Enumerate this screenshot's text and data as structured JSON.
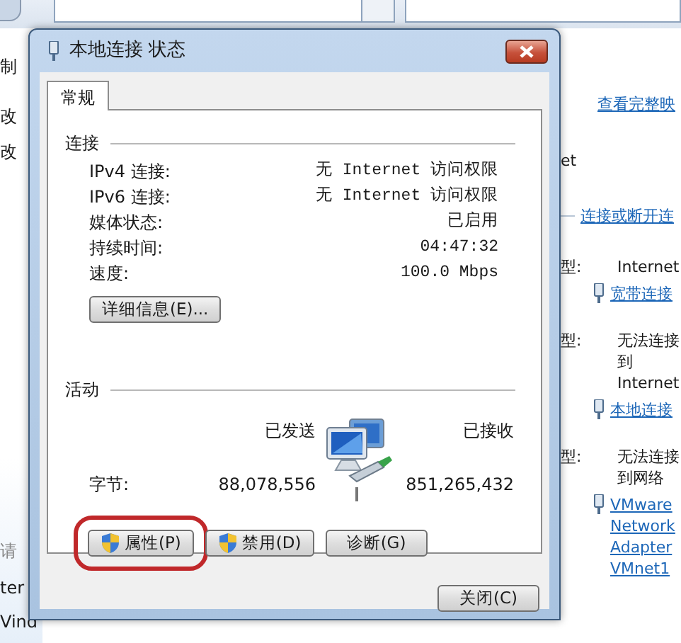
{
  "background": {
    "left_texts": [
      {
        "text": "制",
        "muted": false
      },
      {
        "text": "改",
        "muted": false
      },
      {
        "text": "改",
        "muted": false
      },
      {
        "text": "请",
        "muted": true
      },
      {
        "text": "ter",
        "muted": false
      },
      {
        "text": "Vind",
        "muted": false
      }
    ],
    "right_panel": [
      {
        "kind": "link",
        "text": "查看完整映"
      },
      {
        "kind": "text",
        "text": "et"
      },
      {
        "kind": "section_link",
        "text": "连接或断开连"
      },
      {
        "kind": "network",
        "type_label": "型:",
        "type_value": [
          "Internet"
        ],
        "connection": [
          "宽带连接"
        ]
      },
      {
        "kind": "network",
        "type_label": "型:",
        "type_value": [
          "无法连接",
          "到",
          "Internet"
        ],
        "connection": [
          "本地连接"
        ]
      },
      {
        "kind": "network",
        "type_label": "型:",
        "type_value": [
          "无法连接",
          "到网络"
        ],
        "connection": [
          "VMware",
          "Network",
          "Adapter",
          "VMnet1"
        ]
      }
    ]
  },
  "dialog": {
    "title": "本地连接 状态",
    "tabs": [
      {
        "label": "常规",
        "selected": true
      }
    ],
    "connection": {
      "heading": "连接",
      "rows": [
        {
          "label": "IPv4 连接:",
          "value": "无 Internet 访问权限"
        },
        {
          "label": "IPv6 连接:",
          "value": "无 Internet 访问权限"
        },
        {
          "label": "媒体状态:",
          "value": "已启用"
        },
        {
          "label": "持续时间:",
          "value": "04:47:32"
        },
        {
          "label": "速度:",
          "value": "100.0 Mbps"
        }
      ],
      "details_button": "详细信息(E)..."
    },
    "activity": {
      "heading": "活动",
      "sent_label": "已发送",
      "received_label": "已接收",
      "bytes_label": "字节:",
      "bytes_sent": "88,078,556",
      "bytes_received": "851,265,432"
    },
    "buttons": [
      {
        "label": "属性(P)",
        "shield": true,
        "highlighted": true
      },
      {
        "label": "禁用(D)",
        "shield": true,
        "highlighted": false
      },
      {
        "label": "诊断(G)",
        "shield": false,
        "highlighted": false
      }
    ],
    "close_button": "关闭(C)"
  }
}
